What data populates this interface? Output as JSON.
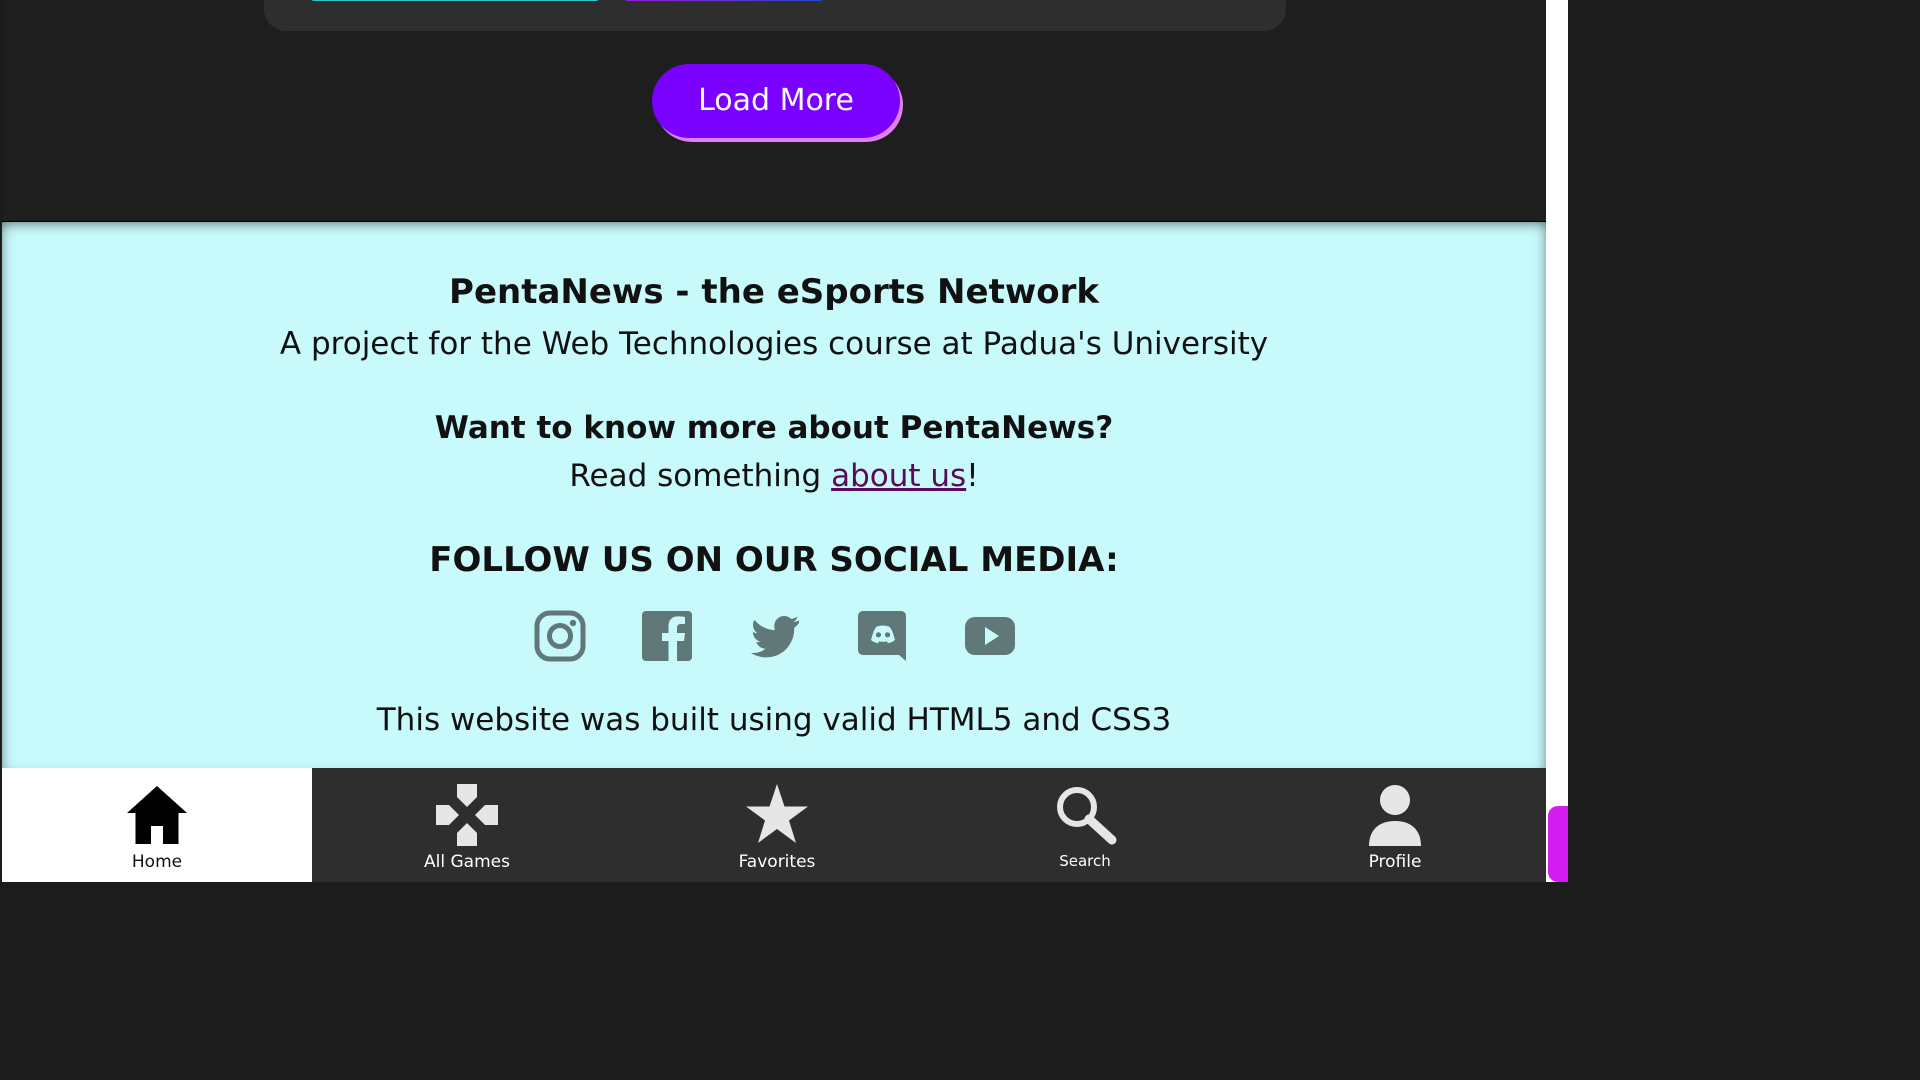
{
  "main": {
    "load_more_label": "Load More"
  },
  "footer": {
    "title": "PentaNews - the eSports Network",
    "subtitle": "A project for the Web Technologies course at Padua's University",
    "about_heading": "Want to know more about PentaNews?",
    "about_prefix": "Read something ",
    "about_link": "about us",
    "about_suffix": "!",
    "social_heading": "FOLLOW US ON OUR SOCIAL MEDIA:",
    "social_icons": [
      "instagram-icon",
      "facebook-icon",
      "twitter-icon",
      "discord-icon",
      "youtube-icon"
    ],
    "built_with": "This website was built using valid HTML5 and CSS3"
  },
  "bottom_nav": {
    "items": [
      {
        "label": "Home",
        "icon": "home-icon",
        "active": true
      },
      {
        "label": "All Games",
        "icon": "gamepad-icon",
        "active": false
      },
      {
        "label": "Favorites",
        "icon": "star-icon",
        "active": false
      },
      {
        "label": "Search",
        "icon": "search-icon",
        "active": false
      },
      {
        "label": "Profile",
        "icon": "person-icon",
        "active": false
      }
    ]
  },
  "colors": {
    "page_background": "#1e1e1e",
    "card_background": "#2e2e2e",
    "button_purple": "#7a00ff",
    "button_shadow": "#e07ff0",
    "footer_background": "#c8fafc",
    "social_icon_gray": "#607878",
    "link_color": "#5a0a5a",
    "nav_background": "#2e2e2e",
    "nav_active_background": "#ffffff",
    "scroll_thumb": "#d21cf0"
  }
}
